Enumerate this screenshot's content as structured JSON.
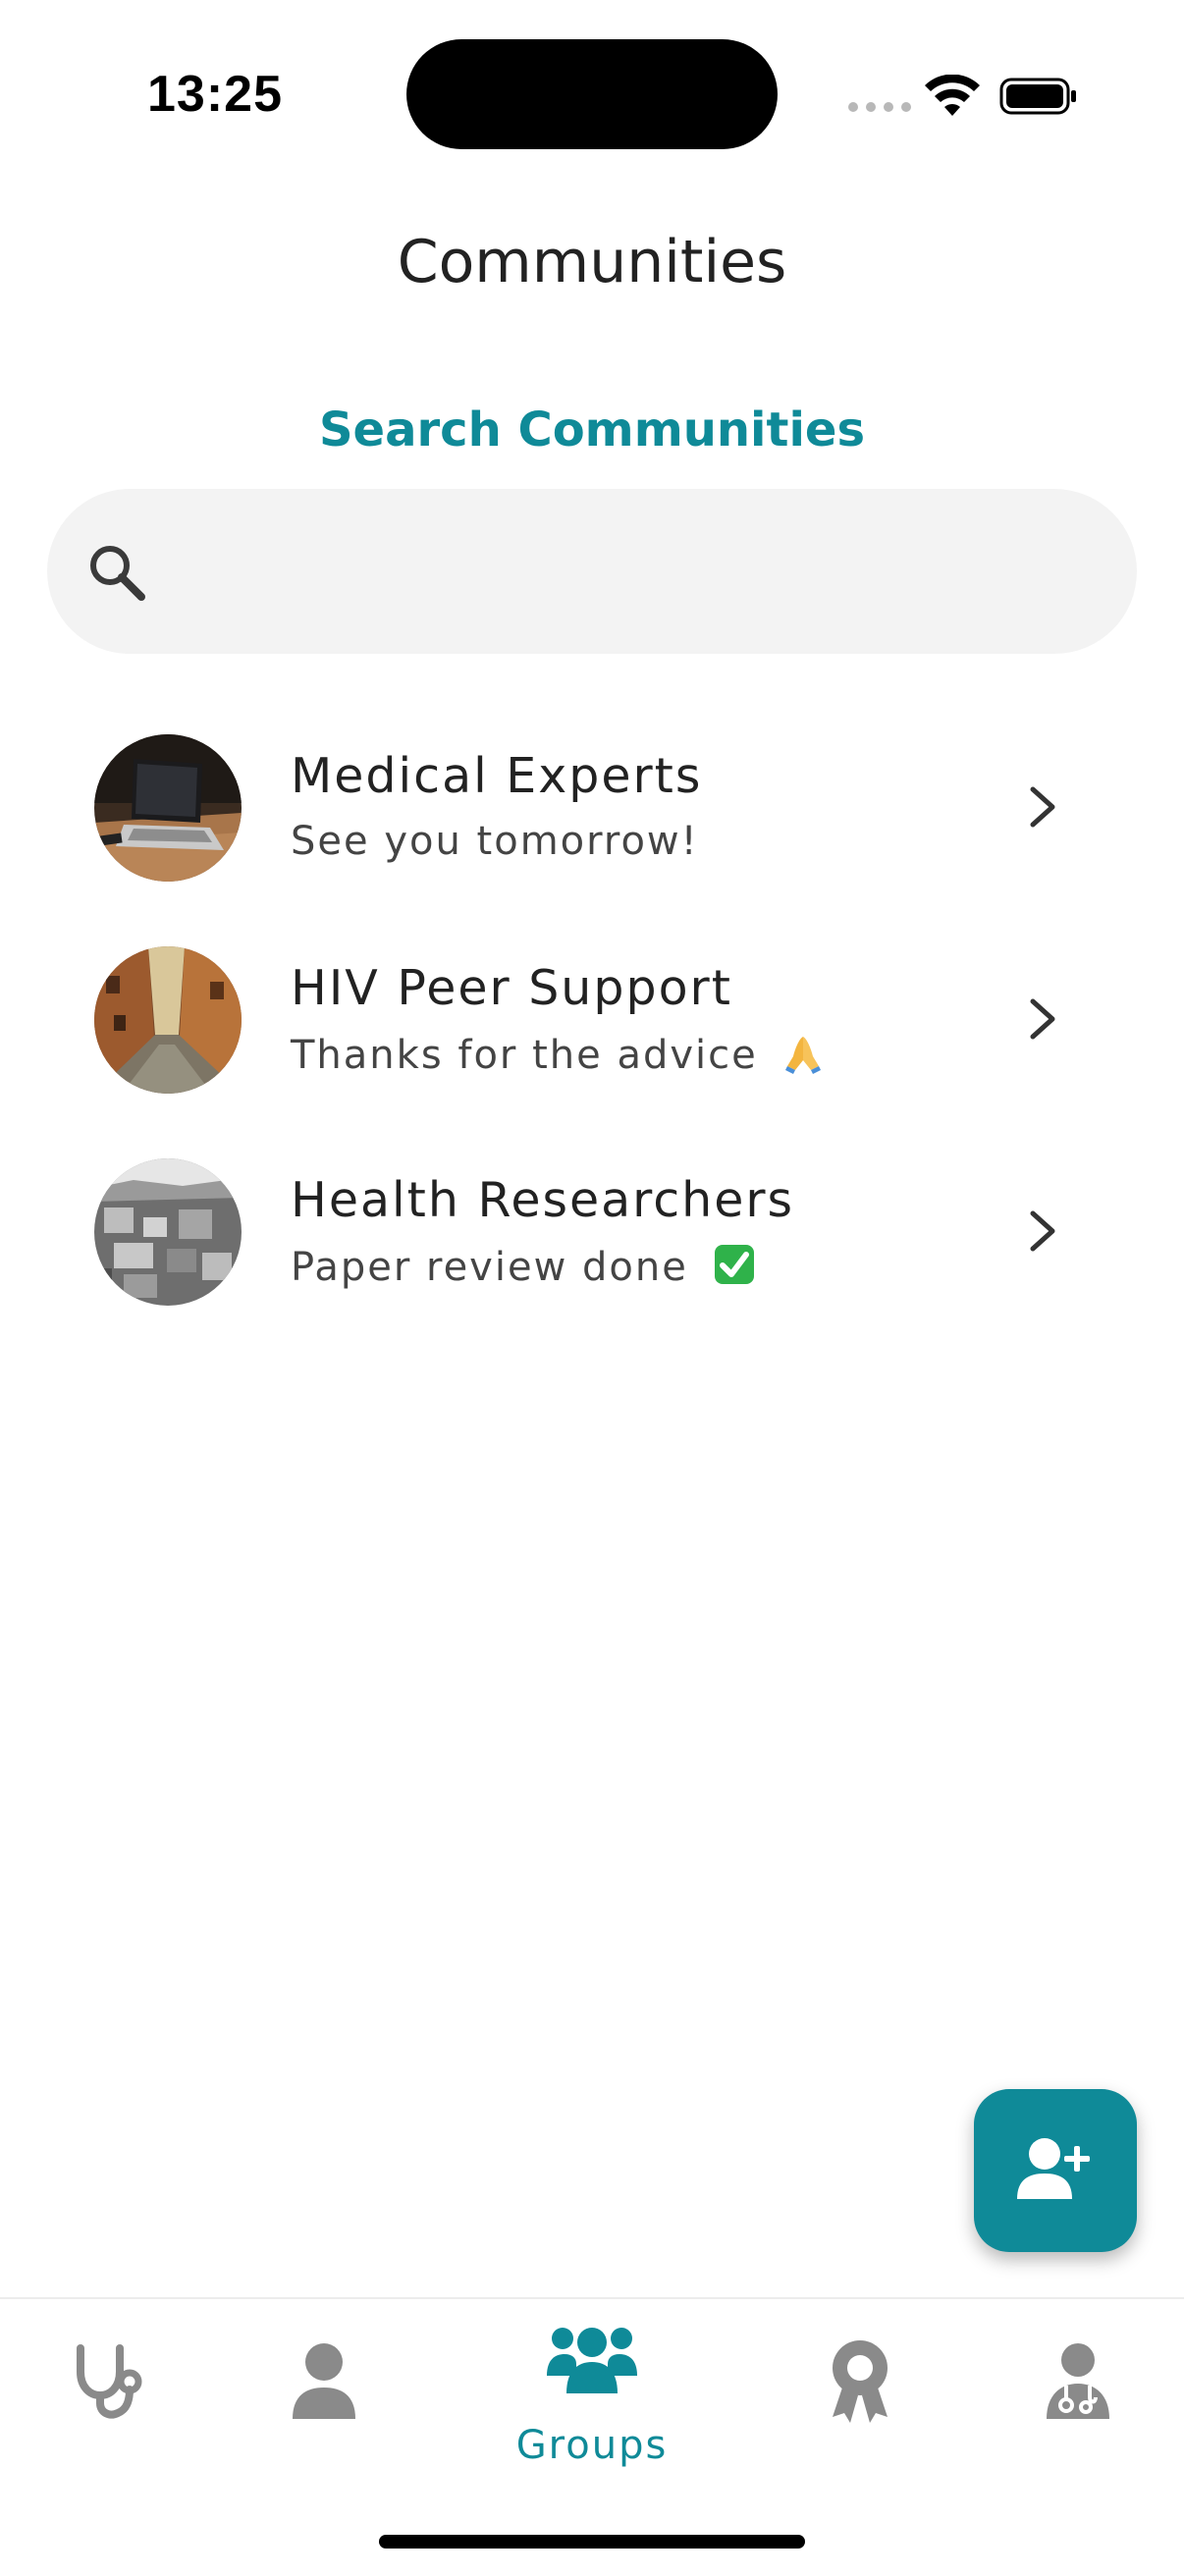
{
  "status_bar": {
    "time": "13:25"
  },
  "header": {
    "title": "Communities"
  },
  "search": {
    "label": "Search Communities",
    "placeholder": "",
    "value": ""
  },
  "communities": [
    {
      "name": "Medical Experts",
      "last_message": "See you tomorrow!",
      "avatar": "laptop-photo",
      "emoji": ""
    },
    {
      "name": "HIV Peer Support",
      "last_message": "Thanks for the advice",
      "avatar": "alley-photo",
      "emoji": "folded-hands-emoji"
    },
    {
      "name": "Health Researchers",
      "last_message": "Paper review done",
      "avatar": "city-photo",
      "emoji": "check-mark-button-emoji"
    }
  ],
  "fab": {
    "icon": "add-user-icon"
  },
  "bottom_nav": {
    "items": [
      {
        "icon": "stethoscope-icon",
        "label": "",
        "active": false
      },
      {
        "icon": "person-icon",
        "label": "",
        "active": false
      },
      {
        "icon": "groups-icon",
        "label": "Groups",
        "active": true
      },
      {
        "icon": "award-icon",
        "label": "",
        "active": false
      },
      {
        "icon": "doctor-icon",
        "label": "",
        "active": false
      }
    ]
  },
  "colors": {
    "accent": "#0f8a98",
    "inactive_icon": "#8a8a8a",
    "search_bg": "#f3f3f3"
  }
}
